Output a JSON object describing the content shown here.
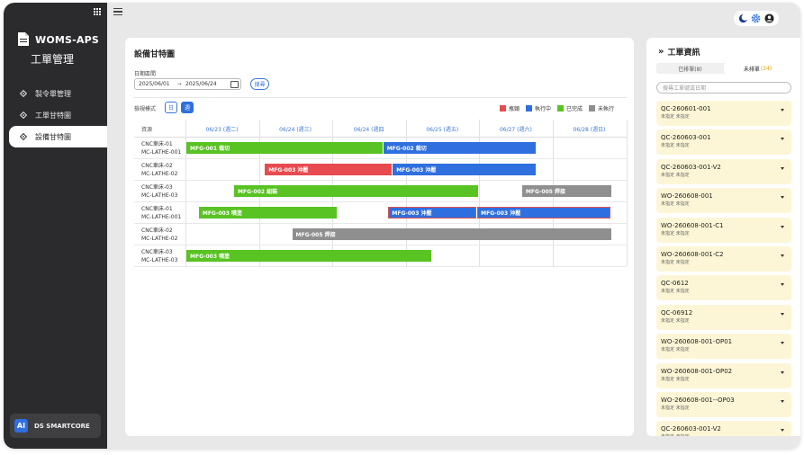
{
  "sidebar": {
    "brand_name": "WOMS-APS",
    "brand_sub": "工單管理",
    "items": [
      {
        "label": "製令單管理",
        "icon": "diamond-icon"
      },
      {
        "label": "工單甘特圖",
        "icon": "diamond-icon"
      },
      {
        "label": "設備甘特圖",
        "icon": "diamond-icon",
        "active": true
      }
    ],
    "footer": {
      "badge": "AI",
      "label": "DS SMARTCORE"
    }
  },
  "topbar": {
    "icons": [
      "moon-icon",
      "gear-icon",
      "user-icon"
    ]
  },
  "main": {
    "title": "設備甘特圖",
    "date_label": "日期區間",
    "date_start": "2025/06/01",
    "date_arrow": "→",
    "date_end": "2025/06/24",
    "search_label": "搜尋",
    "view_label": "檢視模式",
    "view_day": "日",
    "view_week": "週",
    "legend": [
      {
        "label": "瓶頸",
        "color": "#e84b4f"
      },
      {
        "label": "執行中",
        "color": "#2f6fdf"
      },
      {
        "label": "已完成",
        "color": "#58c322"
      },
      {
        "label": "未執行",
        "color": "#8f8f8f"
      }
    ],
    "gantt": {
      "resource_header": "資源",
      "days": [
        "06/23 (週二)",
        "06/24 (週三)",
        "06/24 (週四",
        "06/25 (週五)",
        "06/27 (週六)",
        "06/28 (週日)"
      ],
      "rows": [
        {
          "resource_line1": "CNC車床-01",
          "resource_line2": "MC-LATHE-001",
          "bars": [
            {
              "label": "MFG-001 裁切",
              "status": "completed",
              "start": 0.0,
              "end": 2.68
            },
            {
              "label": "MFG-002 裁切",
              "status": "running",
              "start": 2.68,
              "end": 4.77
            }
          ]
        },
        {
          "resource_line1": "CNC車床-02",
          "resource_line2": "MC-LATHE-02",
          "bars": [
            {
              "label": "MFG-003 沖壓",
              "status": "bottleneck",
              "start": 1.07,
              "end": 2.81
            },
            {
              "label": "MFG-003 沖壓",
              "status": "running",
              "start": 2.81,
              "end": 4.77
            }
          ]
        },
        {
          "resource_line1": "CNC車床-03",
          "resource_line2": "MC-LATHE-03",
          "bars": [
            {
              "label": "MFG-002 組裝",
              "status": "completed",
              "start": 0.65,
              "end": 3.98
            },
            {
              "label": "MFG-005 焊接",
              "status": "pending",
              "start": 4.57,
              "end": 5.8
            }
          ]
        },
        {
          "resource_line1": "CNC車床-01",
          "resource_line2": "MC-LATHE-001",
          "bars": [
            {
              "label": "MFG-003 噴塗",
              "status": "completed",
              "start": 0.17,
              "end": 2.06
            },
            {
              "label": "MFG-003 沖壓",
              "status": "running",
              "start": 2.75,
              "end": 3.96,
              "highlight": true
            },
            {
              "label": "MFG-003 沖壓",
              "status": "running",
              "start": 3.96,
              "end": 5.78,
              "highlight": true
            }
          ]
        },
        {
          "resource_line1": "CNC車床-02",
          "resource_line2": "MC-LATHE-02",
          "bars": [
            {
              "label": "MFG-005 焊接",
              "status": "pending",
              "start": 1.44,
              "end": 5.8
            }
          ]
        },
        {
          "resource_line1": "CNC車床-03",
          "resource_line2": "MC-LATHE-03",
          "bars": [
            {
              "label": "MFG-003 噴塗",
              "status": "completed",
              "start": 0.0,
              "end": 3.34
            }
          ]
        }
      ]
    }
  },
  "panel": {
    "title": "工單資訊",
    "tab_scheduled": "已排單(8)",
    "tab_unscheduled": "未排單",
    "tab_unscheduled_count": "(34)",
    "search_placeholder": "搜尋工單號或日期",
    "work_orders": [
      {
        "code": "QC-260601-001",
        "sub": "未指定 未指定"
      },
      {
        "code": "QC-260603-001",
        "sub": "未指定 未指定"
      },
      {
        "code": "QC-260603-001-V2",
        "sub": "未指定 未指定"
      },
      {
        "code": "WO-260608-001",
        "sub": "未指定 未指定"
      },
      {
        "code": "WO-260608-001-C1",
        "sub": "未指定 未指定"
      },
      {
        "code": "WO-260608-001-C2",
        "sub": "未指定 未指定"
      },
      {
        "code": "QC-0612",
        "sub": "未指定 未指定"
      },
      {
        "code": "QC-06912",
        "sub": "未指定 未指定"
      },
      {
        "code": "WO-260608-001-OP01",
        "sub": "未指定 未指定"
      },
      {
        "code": "WO-260608-001-OP02",
        "sub": "未指定 未指定"
      },
      {
        "code": "WO-260608-001--OP03",
        "sub": "未指定 未指定"
      },
      {
        "code": "QC-260603-001-V2",
        "sub": "未指定 未指定"
      }
    ]
  }
}
